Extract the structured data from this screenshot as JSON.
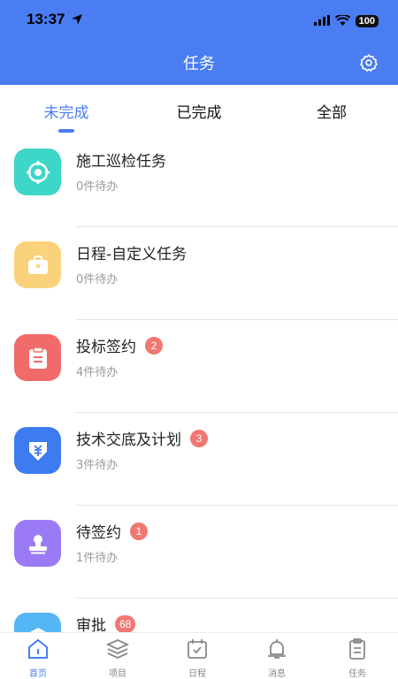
{
  "status_bar": {
    "time": "13:37",
    "battery": "100"
  },
  "header": {
    "title": "任务"
  },
  "tabs": [
    {
      "label": "未完成",
      "active": true
    },
    {
      "label": "已完成",
      "active": false
    },
    {
      "label": "全部",
      "active": false
    }
  ],
  "tasks": [
    {
      "name": "施工巡检任务",
      "badge": "",
      "pending": "0件待办",
      "color": "#3ED6C8",
      "icon": "crosshair-icon"
    },
    {
      "name": "日程-自定义任务",
      "badge": "",
      "pending": "0件待办",
      "color": "#FBD27C",
      "icon": "briefcase-icon"
    },
    {
      "name": "投标签约",
      "badge": "2",
      "pending": "4件待办",
      "color": "#F26B6B",
      "icon": "clipboard-icon"
    },
    {
      "name": "技术交底及计划",
      "badge": "3",
      "pending": "3件待办",
      "color": "#3D7BF0",
      "icon": "yuan-shield-icon"
    },
    {
      "name": "待签约",
      "badge": "1",
      "pending": "1件待办",
      "color": "#9B7BF5",
      "icon": "stamp-icon"
    },
    {
      "name": "审批",
      "badge": "68",
      "pending": "",
      "color": "#54B6F5",
      "icon": "layers-icon"
    }
  ],
  "bottom_nav": [
    {
      "label": "首页",
      "active": true,
      "icon": "home-icon"
    },
    {
      "label": "项目",
      "active": false,
      "icon": "layers-icon"
    },
    {
      "label": "日程",
      "active": false,
      "icon": "calendar-icon"
    },
    {
      "label": "消息",
      "active": false,
      "icon": "bell-icon"
    },
    {
      "label": "任务",
      "active": false,
      "icon": "task-list-icon"
    }
  ],
  "colors": {
    "primary": "#4A7CF2",
    "badge": "#F07772"
  }
}
